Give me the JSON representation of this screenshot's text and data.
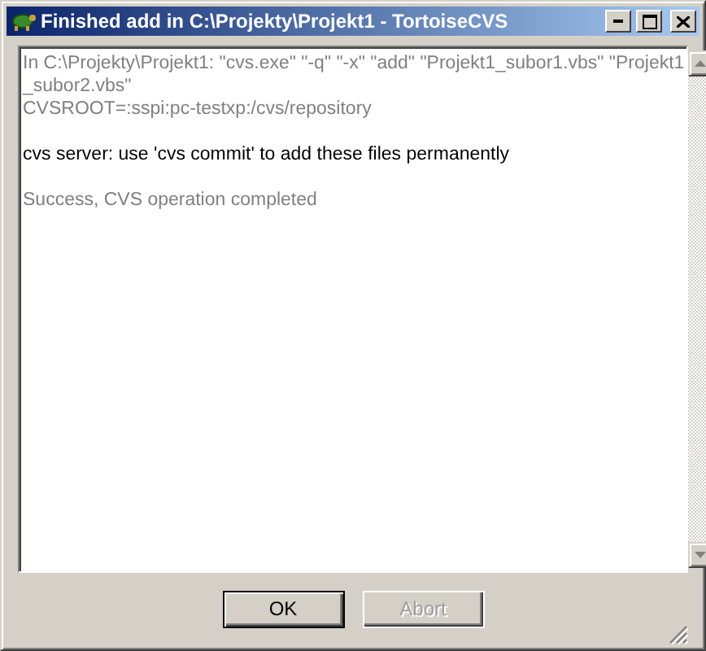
{
  "window": {
    "title": "Finished add in C:\\Projekty\\Projekt1 - TortoiseCVS"
  },
  "log": [
    {
      "kind": "info",
      "lines": [
        "In C:\\Projekty\\Projekt1: \"cvs.exe\" \"-q\" \"-x\" \"add\" \"Projekt1_subor1.vbs\" \"Projekt1",
        "_subor2.vbs\"",
        "CVSROOT=:sspi:pc-testxp:/cvs/repository"
      ]
    },
    {
      "kind": "output",
      "lines": [
        "cvs server: use 'cvs commit' to add these files permanently"
      ]
    },
    {
      "kind": "info",
      "lines": [
        "Success, CVS operation completed"
      ]
    }
  ],
  "buttons": [
    {
      "label": "OK",
      "default": true,
      "disabled": false
    },
    {
      "label": "Abort",
      "default": false,
      "disabled": true
    }
  ]
}
